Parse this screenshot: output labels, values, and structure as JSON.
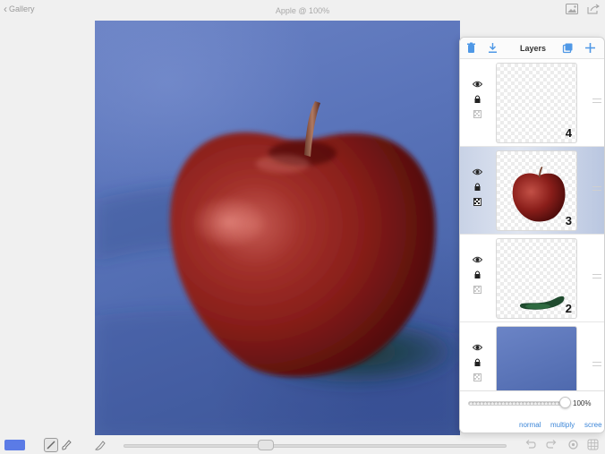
{
  "topbar": {
    "back_label": "Gallery",
    "title": "Apple @ 100%",
    "right_icons": [
      "image-icon",
      "share-icon"
    ]
  },
  "layers_panel": {
    "title": "Layers",
    "header_icons": [
      "trash-icon",
      "merge-down-icon",
      "duplicate-icon",
      "add-icon"
    ],
    "layers": [
      {
        "number": "4",
        "visible": true,
        "locked": true,
        "selected": false,
        "content": "empty"
      },
      {
        "number": "3",
        "visible": true,
        "locked": true,
        "selected": true,
        "content": "apple"
      },
      {
        "number": "2",
        "visible": true,
        "locked": true,
        "selected": false,
        "content": "shadow"
      },
      {
        "number": "",
        "visible": true,
        "locked": true,
        "selected": false,
        "content": "background"
      }
    ],
    "opacity": "100%",
    "opacity_level": 1.0,
    "blend_modes": [
      "normal",
      "multiply",
      "scree"
    ]
  },
  "bottombar": {
    "color": "#5b7be6",
    "icons": [
      "brush-icon",
      "smudge-icon",
      "eraser-icon",
      "undo-icon",
      "redo-icon",
      "settings-icon",
      "grid-icon"
    ]
  },
  "colors": {
    "accent": "#3c86d8",
    "panel_selected": "#c8d2e6",
    "apple_red": "#8e1f1a",
    "canvas_blue": "#5a74ba"
  }
}
